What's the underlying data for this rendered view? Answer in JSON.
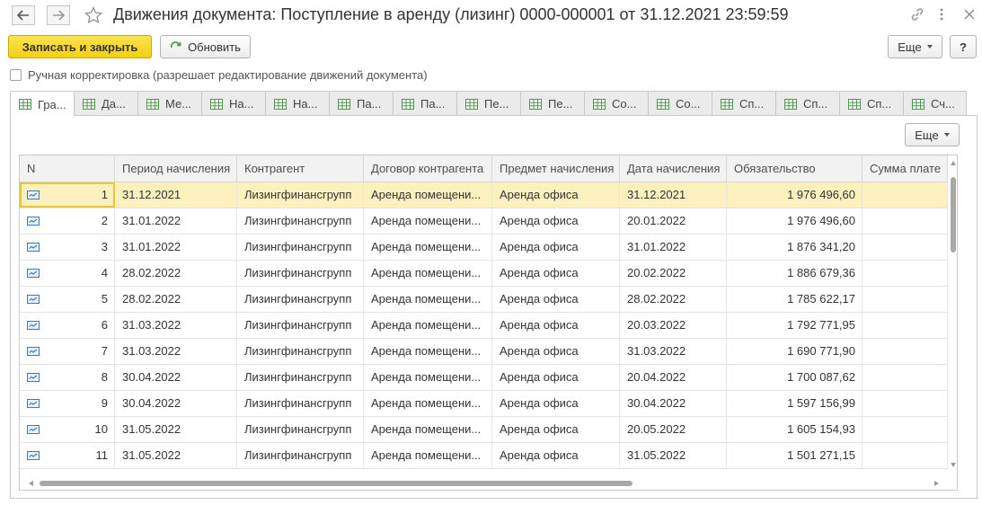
{
  "window": {
    "title": "Движения документа: Поступление в аренду (лизинг) 0000-000001 от 31.12.2021 23:59:59",
    "back_icon": "arrow-left-icon",
    "forward_icon": "arrow-right-icon",
    "favorite_icon": "star-icon",
    "link_icon": "link-icon",
    "menu_icon": "kebab-menu-icon",
    "close_icon": "close-icon"
  },
  "toolbar": {
    "save_close_label": "Записать и закрыть",
    "refresh_label": "Обновить",
    "more_label": "Еще",
    "help_label": "?"
  },
  "manual_adjust": {
    "label": "Ручная корректировка (разрешает редактирование движений документа)",
    "checked": false
  },
  "tabs": [
    {
      "label": "Гра..."
    },
    {
      "label": "Да..."
    },
    {
      "label": "Ме..."
    },
    {
      "label": "На..."
    },
    {
      "label": "На..."
    },
    {
      "label": "Па..."
    },
    {
      "label": "Па..."
    },
    {
      "label": "Пе..."
    },
    {
      "label": "Пе..."
    },
    {
      "label": "Со..."
    },
    {
      "label": "Со..."
    },
    {
      "label": "Сп..."
    },
    {
      "label": "Сп..."
    },
    {
      "label": "Сп..."
    },
    {
      "label": "Сч..."
    }
  ],
  "panel": {
    "more_label": "Еще"
  },
  "table": {
    "columns": [
      "N",
      "Период начисления",
      "Контрагент",
      "Договор контрагента",
      "Предмет начисления",
      "Дата начисления",
      "Обязательство",
      "Сумма плате"
    ],
    "rows": [
      {
        "n": "1",
        "period": "31.12.2021",
        "contractor": "Лизингфинансгрупп",
        "contract": "Аренда помещени...",
        "subject": "Аренда офиса",
        "date": "31.12.2021",
        "obligation": "1 976 496,60",
        "payment": ""
      },
      {
        "n": "2",
        "period": "31.01.2022",
        "contractor": "Лизингфинансгрупп",
        "contract": "Аренда помещени...",
        "subject": "Аренда офиса",
        "date": "20.01.2022",
        "obligation": "1 976 496,60",
        "payment": ""
      },
      {
        "n": "3",
        "period": "31.01.2022",
        "contractor": "Лизингфинансгрупп",
        "contract": "Аренда помещени...",
        "subject": "Аренда офиса",
        "date": "31.01.2022",
        "obligation": "1 876 341,20",
        "payment": ""
      },
      {
        "n": "4",
        "period": "28.02.2022",
        "contractor": "Лизингфинансгрупп",
        "contract": "Аренда помещени...",
        "subject": "Аренда офиса",
        "date": "20.02.2022",
        "obligation": "1 886 679,36",
        "payment": ""
      },
      {
        "n": "5",
        "period": "28.02.2022",
        "contractor": "Лизингфинансгрупп",
        "contract": "Аренда помещени...",
        "subject": "Аренда офиса",
        "date": "28.02.2022",
        "obligation": "1 785 622,17",
        "payment": ""
      },
      {
        "n": "6",
        "period": "31.03.2022",
        "contractor": "Лизингфинансгрупп",
        "contract": "Аренда помещени...",
        "subject": "Аренда офиса",
        "date": "20.03.2022",
        "obligation": "1 792 771,95",
        "payment": ""
      },
      {
        "n": "7",
        "period": "31.03.2022",
        "contractor": "Лизингфинансгрупп",
        "contract": "Аренда помещени...",
        "subject": "Аренда офиса",
        "date": "31.03.2022",
        "obligation": "1 690 771,90",
        "payment": ""
      },
      {
        "n": "8",
        "period": "30.04.2022",
        "contractor": "Лизингфинансгрупп",
        "contract": "Аренда помещени...",
        "subject": "Аренда офиса",
        "date": "20.04.2022",
        "obligation": "1 700 087,62",
        "payment": ""
      },
      {
        "n": "9",
        "period": "30.04.2022",
        "contractor": "Лизингфинансгрупп",
        "contract": "Аренда помещени...",
        "subject": "Аренда офиса",
        "date": "30.04.2022",
        "obligation": "1 597 156,99",
        "payment": ""
      },
      {
        "n": "10",
        "period": "31.05.2022",
        "contractor": "Лизингфинансгрупп",
        "contract": "Аренда помещени...",
        "subject": "Аренда офиса",
        "date": "20.05.2022",
        "obligation": "1 605 154,93",
        "payment": ""
      },
      {
        "n": "11",
        "period": "31.05.2022",
        "contractor": "Лизингфинансгрупп",
        "contract": "Аренда помещени...",
        "subject": "Аренда офиса",
        "date": "31.05.2022",
        "obligation": "1 501 271,15",
        "payment": ""
      }
    ],
    "selected_row": 0,
    "row_icon": "register-record-icon"
  },
  "colors": {
    "primary_button": "#f3cf16",
    "selected_row": "#fbf0be",
    "header_bg": "#f2f2f2"
  }
}
